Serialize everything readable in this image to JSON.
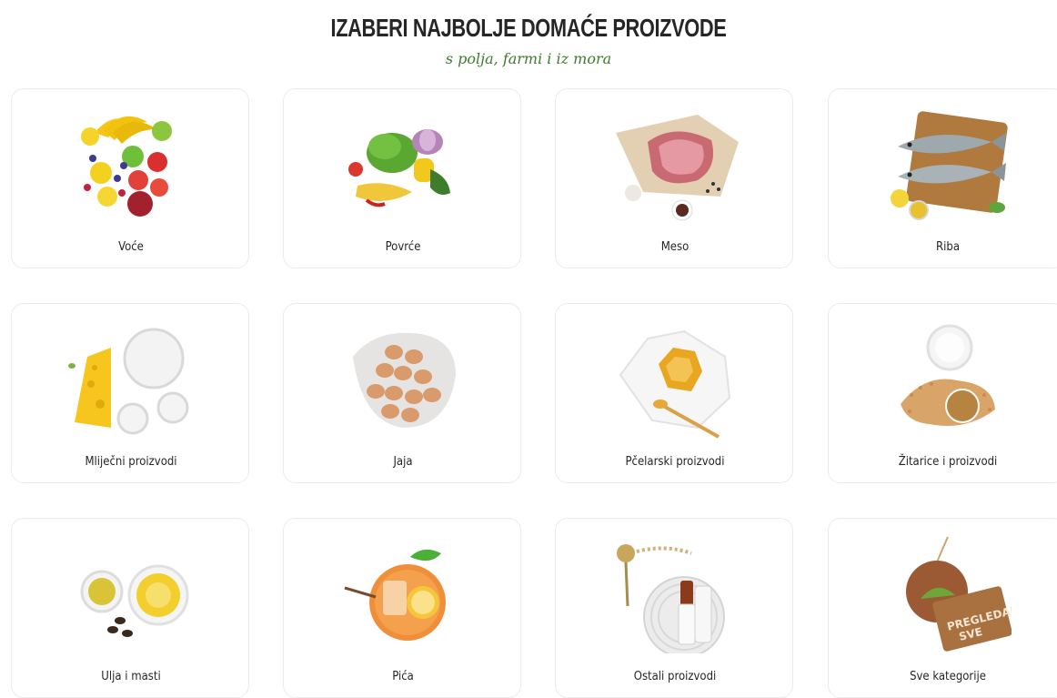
{
  "header": {
    "title": "IZABERI NAJBOLJE DOMAĆE PROIZVODE",
    "subtitle": "s polja, farmi i iz mora"
  },
  "colors": {
    "accent_green": "#3f7a2d",
    "card_border": "#ebebeb"
  },
  "categories": [
    {
      "label": "Voće",
      "icon": "fruit-icon"
    },
    {
      "label": "Povrće",
      "icon": "vegetables-icon"
    },
    {
      "label": "Meso",
      "icon": "meat-icon"
    },
    {
      "label": "Riba",
      "icon": "fish-icon"
    },
    {
      "label": "Mliječni proizvodi",
      "icon": "dairy-icon"
    },
    {
      "label": "Jaja",
      "icon": "eggs-icon"
    },
    {
      "label": "Pčelarski proizvodi",
      "icon": "honey-icon"
    },
    {
      "label": "Žitarice i proizvodi",
      "icon": "grains-icon"
    },
    {
      "label": "Ulja i masti",
      "icon": "oil-icon"
    },
    {
      "label": "Pića",
      "icon": "drink-icon"
    },
    {
      "label": "Ostali proizvodi",
      "icon": "other-products-icon"
    },
    {
      "label": "Sve kategorije",
      "icon": "all-categories-icon"
    }
  ],
  "all_tag_text": [
    "PREGLEDAJ",
    "SVE"
  ]
}
